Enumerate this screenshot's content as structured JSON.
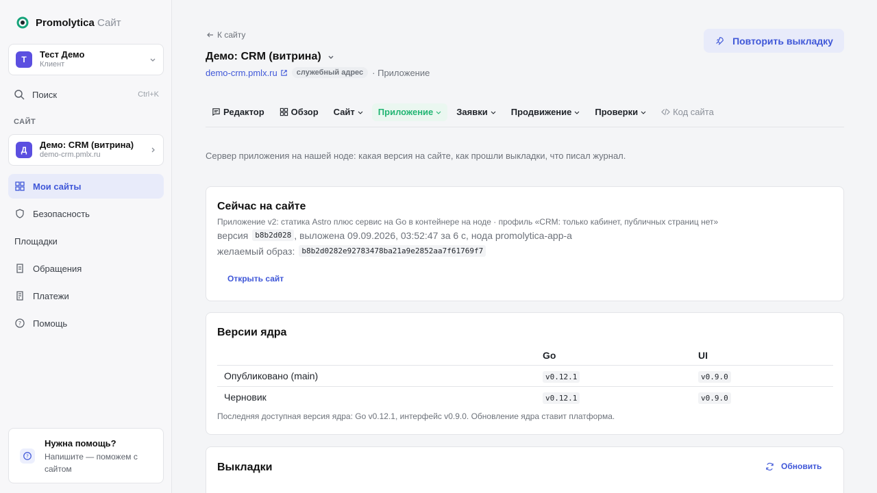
{
  "brand": {
    "name": "Promolytica",
    "sub": "Сайт"
  },
  "client": {
    "initial": "Т",
    "name": "Тест Демо",
    "role": "Клиент"
  },
  "search": {
    "label": "Поиск",
    "shortcut": "Ctrl+K"
  },
  "sidebar": {
    "section_label": "САЙТ",
    "site": {
      "initial": "Д",
      "name": "Демо: CRM (витрина)",
      "domain": "demo-crm.pmlx.ru"
    },
    "items": [
      {
        "label": "Мои сайты"
      },
      {
        "label": "Безопасность"
      },
      {
        "label": "Площадки"
      },
      {
        "label": "Обращения"
      },
      {
        "label": "Платежи"
      },
      {
        "label": "Помощь"
      }
    ],
    "help": {
      "title": "Нужна помощь?",
      "text": "Напишите — поможем с сайтом"
    }
  },
  "header": {
    "back": "К сайту",
    "title": "Демо: CRM (витрина)",
    "domain": "demo-crm.pmlx.ru",
    "badge": "служебный адрес",
    "type": "· Приложение",
    "redeploy": "Повторить выкладку"
  },
  "tabs": [
    {
      "label": "Редактор"
    },
    {
      "label": "Обзор"
    },
    {
      "label": "Сайт"
    },
    {
      "label": "Приложение"
    },
    {
      "label": "Заявки"
    },
    {
      "label": "Продвижение"
    },
    {
      "label": "Проверки"
    },
    {
      "label": "Код сайта"
    }
  ],
  "description": "Сервер приложения на нашей ноде: какая версия на сайте, как прошли выкладки, что писал журнал.",
  "now": {
    "title": "Сейчас на сайте",
    "subtitle": "Приложение v2: статика Astro плюс сервис на Go в контейнере на ноде · профиль «CRM: только кабинет, публичных страниц нет»",
    "version_label": "версия",
    "version": "b8b2d028",
    "version_rest": ", выложена 09.09.2026, 03:52:47 за 6 с, нода promolytica-app-a",
    "image_label": "желаемый образ:",
    "image": "b8b2d0282e92783478ba21a9e2852aa7f61769f7",
    "open": "Открыть сайт"
  },
  "core": {
    "title": "Версии ядра",
    "columns": [
      "",
      "Go",
      "UI"
    ],
    "rows": [
      {
        "name": "Опубликовано (main)",
        "go": "v0.12.1",
        "ui": "v0.9.0"
      },
      {
        "name": "Черновик",
        "go": "v0.12.1",
        "ui": "v0.9.0"
      }
    ],
    "note": "Последняя доступная версия ядра: Go v0.12.1, интерфейс v0.9.0. Обновление ядра ставит платформа."
  },
  "deploys": {
    "title": "Выкладки",
    "refresh": "Обновить"
  }
}
